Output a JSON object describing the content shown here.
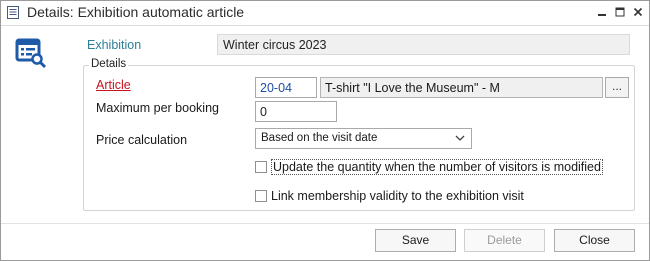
{
  "window": {
    "title": "Details: Exhibition automatic article"
  },
  "exhibition": {
    "label": "Exhibition",
    "value": "Winter circus 2023"
  },
  "details": {
    "legend": "Details",
    "article": {
      "label": "Article",
      "code": "20-04",
      "name": "T-shirt \"I Love the Museum\" - M",
      "browse_label": "..."
    },
    "max_per_booking": {
      "label": "Maximum per booking",
      "value": "0"
    },
    "price_calculation": {
      "label": "Price calculation",
      "selected": "Based on the visit date"
    },
    "checkboxes": [
      {
        "label": "Update the quantity when the number of visitors is modified",
        "checked": false
      },
      {
        "label": "Link membership validity to the exhibition visit",
        "checked": false
      }
    ]
  },
  "buttons": {
    "save": "Save",
    "delete": "Delete",
    "close": "Close"
  },
  "colors": {
    "accent_label": "#2c7f96",
    "required_label": "#c8141e",
    "code_text": "#1e4fa8"
  },
  "icons": {
    "title": "document-icon",
    "main": "article-search-icon"
  }
}
